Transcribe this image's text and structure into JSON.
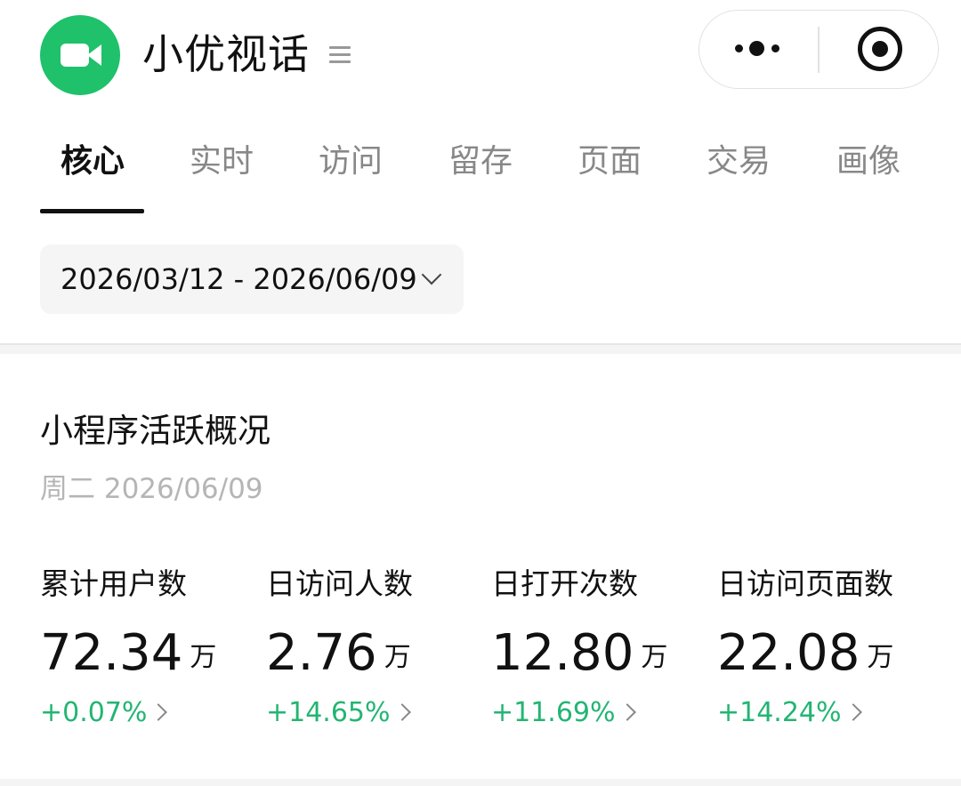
{
  "header": {
    "title": "小优视话",
    "logo_icon": "video-camera-icon",
    "menu_icon": "hamburger-icon",
    "capsule": {
      "more_icon": "more-dots-icon",
      "close_icon": "target-close-icon"
    },
    "brand_color": "#1fc16b"
  },
  "tabs": [
    {
      "label": "核心",
      "active": true
    },
    {
      "label": "实时",
      "active": false
    },
    {
      "label": "访问",
      "active": false
    },
    {
      "label": "留存",
      "active": false
    },
    {
      "label": "页面",
      "active": false
    },
    {
      "label": "交易",
      "active": false
    },
    {
      "label": "画像",
      "active": false
    }
  ],
  "date_range": {
    "value": "2026/03/12 - 2026/06/09",
    "icon": "chevron-down-icon"
  },
  "overview": {
    "title": "小程序活跃概况",
    "date": "周二 2026/06/09",
    "metrics": [
      {
        "label": "累计用户数",
        "value": "72.34",
        "unit": "万",
        "change": "+0.07%"
      },
      {
        "label": "日访问人数",
        "value": "2.76",
        "unit": "万",
        "change": "+14.65%"
      },
      {
        "label": "日打开次数",
        "value": "12.80",
        "unit": "万",
        "change": "+11.69%"
      },
      {
        "label": "日访问页面数",
        "value": "22.08",
        "unit": "万",
        "change": "+14.24%"
      }
    ],
    "positive_color": "#22b573"
  }
}
